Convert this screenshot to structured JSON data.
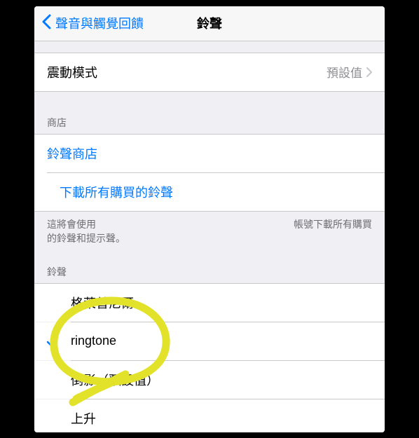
{
  "nav": {
    "back_label": "聲音與觸覺回饋",
    "title": "鈴聲"
  },
  "vibration": {
    "label": "震動模式",
    "value": "預設值"
  },
  "store": {
    "header": "商店",
    "tone_store": "鈴聲商店",
    "download_all": "下載所有購買的鈴聲",
    "footer_left": "這將會使用",
    "footer_left_line2": "的鈴聲和提示聲。",
    "footer_right": "帳號下載所有購買"
  },
  "ringtones": {
    "header": "鈴聲",
    "items": [
      {
        "label": "格萊普尼爾",
        "selected": false
      },
      {
        "label": "ringtone",
        "selected": true
      },
      {
        "label": "倒影（預設值）",
        "selected": false
      },
      {
        "label": "上升",
        "selected": false
      }
    ]
  },
  "colors": {
    "accent": "#007aff",
    "annotation": "#e3e22a"
  }
}
